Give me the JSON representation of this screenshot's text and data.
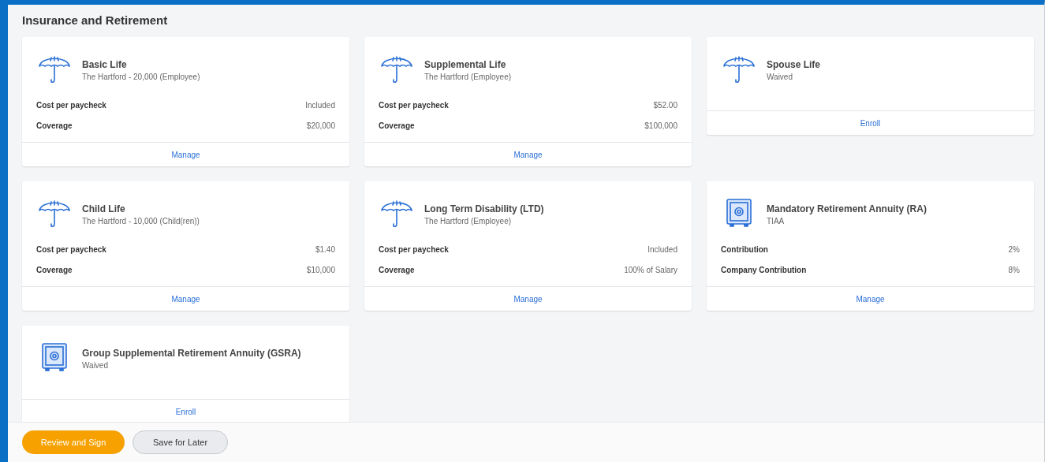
{
  "section_title": "Insurance and Retirement",
  "cards": [
    {
      "kind": "umbrella",
      "title": "Basic Life",
      "subtitle": "The Hartford - 20,000 (Employee)",
      "rows": [
        {
          "label": "Cost per paycheck",
          "value": "Included"
        },
        {
          "label": "Coverage",
          "value": "$20,000"
        }
      ],
      "action": "Manage"
    },
    {
      "kind": "umbrella",
      "title": "Supplemental Life",
      "subtitle": "The Hartford (Employee)",
      "rows": [
        {
          "label": "Cost per paycheck",
          "value": "$52.00"
        },
        {
          "label": "Coverage",
          "value": "$100,000"
        }
      ],
      "action": "Manage"
    },
    {
      "kind": "umbrella",
      "title": "Spouse Life",
      "subtitle": "Waived",
      "action": "Enroll"
    },
    {
      "kind": "umbrella",
      "title": "Child Life",
      "subtitle": "The Hartford - 10,000 (Child(ren))",
      "rows": [
        {
          "label": "Cost per paycheck",
          "value": "$1.40"
        },
        {
          "label": "Coverage",
          "value": "$10,000"
        }
      ],
      "action": "Manage"
    },
    {
      "kind": "umbrella",
      "title": "Long Term Disability (LTD)",
      "subtitle": "The Hartford (Employee)",
      "rows": [
        {
          "label": "Cost per paycheck",
          "value": "Included"
        },
        {
          "label": "Coverage",
          "value": "100% of Salary"
        }
      ],
      "action": "Manage"
    },
    {
      "kind": "safe",
      "title": "Mandatory Retirement Annuity (RA)",
      "subtitle": "TIAA",
      "rows": [
        {
          "label": "Contribution",
          "value": "2%"
        },
        {
          "label": "Company Contribution",
          "value": "8%"
        }
      ],
      "action": "Manage"
    },
    {
      "kind": "safe",
      "title": "Group Supplemental Retirement Annuity (GSRA)",
      "subtitle": "Waived",
      "action": "Enroll"
    }
  ],
  "footer_buttons": [
    {
      "label": "Review and Sign",
      "kind": "primary"
    },
    {
      "label": "Save for Later",
      "kind": "secondary"
    }
  ]
}
